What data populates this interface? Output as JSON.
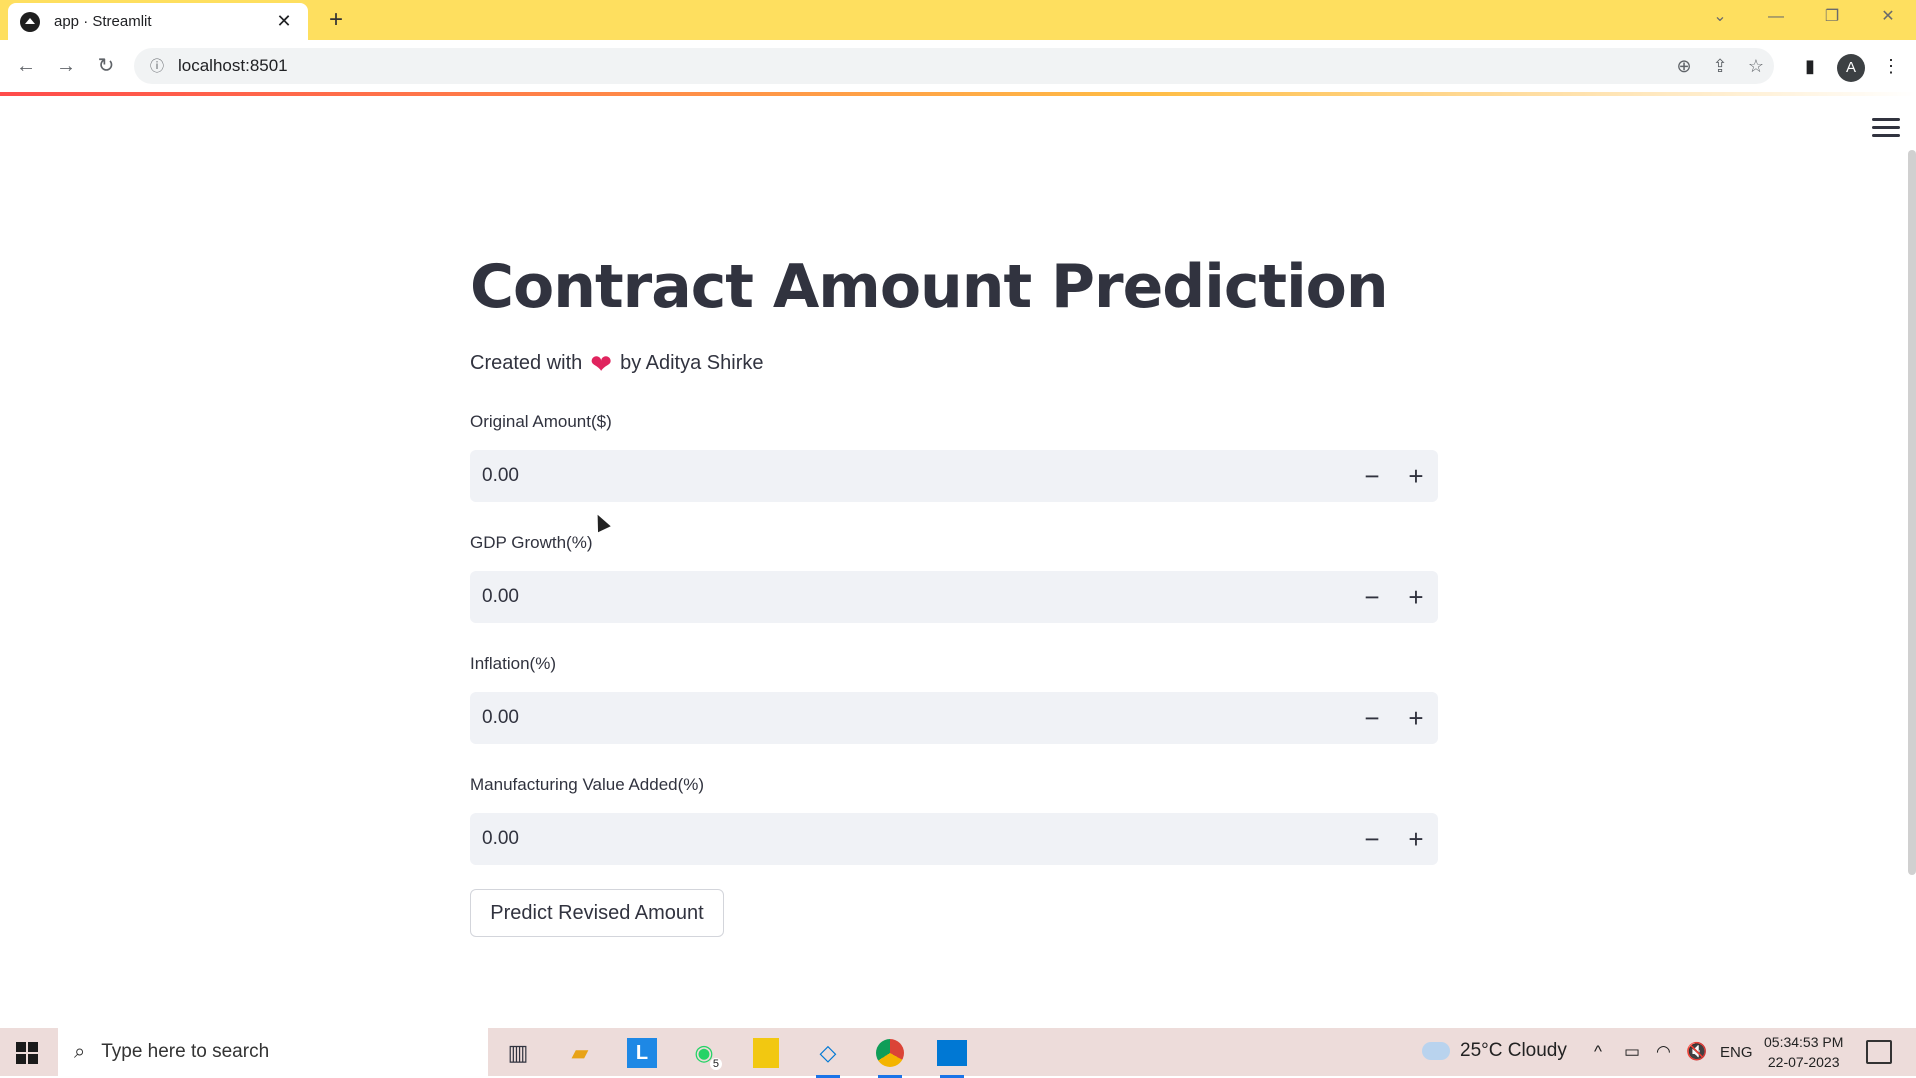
{
  "browser": {
    "tab_title": "app · Streamlit",
    "url": "localhost:8501",
    "profile_initial": "A"
  },
  "page": {
    "title": "Contract Amount Prediction",
    "credit_prefix": "Created with",
    "credit_suffix": "by Aditya Shirke",
    "fields": [
      {
        "label": "Original Amount($)",
        "value": "0.00"
      },
      {
        "label": "GDP Growth(%)",
        "value": "0.00"
      },
      {
        "label": "Inflation(%)",
        "value": "0.00"
      },
      {
        "label": "Manufacturing Value Added(%)",
        "value": "0.00"
      }
    ],
    "button_label": "Predict Revised Amount",
    "stepper_minus": "−",
    "stepper_plus": "+"
  },
  "taskbar": {
    "search_placeholder": "Type here to search",
    "weather": "25°C  Cloudy",
    "language": "ENG",
    "time": "05:34:53 PM",
    "date": "22-07-2023",
    "whatsapp_badge": "5"
  },
  "colors": {
    "tab_strip": "#fedf5f",
    "input_bg": "#f0f2f6",
    "text": "#31333f",
    "heart": "#e0245e"
  }
}
